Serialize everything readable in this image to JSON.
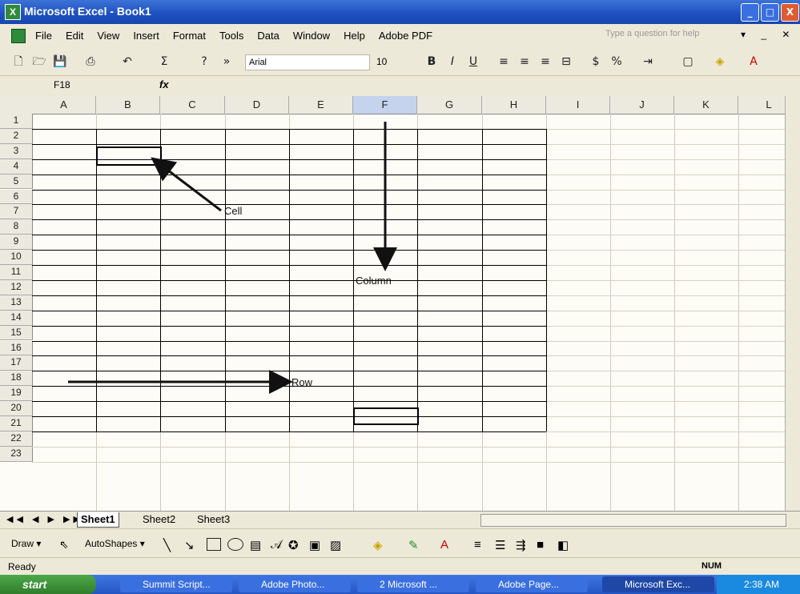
{
  "window": {
    "title": "Microsoft Excel - Book1",
    "minimize": "_",
    "maximize": "□",
    "close": "X"
  },
  "menu": {
    "items": [
      "File",
      "Edit",
      "View",
      "Insert",
      "Format",
      "Tools",
      "Data",
      "Window",
      "Help",
      "Adobe PDF"
    ],
    "help_placeholder": "Type a question for help",
    "mdi_controls": "▾ _ ✕"
  },
  "toolbar": {
    "font": "Arial",
    "font_size": "10",
    "bold": "B",
    "italic": "I",
    "underline": "U",
    "autosum": "Σ",
    "percent": "%",
    "currency": "$"
  },
  "formula_bar": {
    "name_box": "F18",
    "fx": "fx"
  },
  "grid": {
    "columns": [
      "A",
      "B",
      "C",
      "D",
      "E",
      "F",
      "G",
      "H",
      "I",
      "J",
      "K",
      "L"
    ],
    "selected_column": "F",
    "rows": [
      "1",
      "2",
      "3",
      "4",
      "5",
      "6",
      "7",
      "8",
      "9",
      "10",
      "11",
      "12",
      "13",
      "14",
      "15",
      "16",
      "17",
      "18",
      "19",
      "20",
      "21",
      "22",
      "23"
    ],
    "annotations": {
      "cell": "Cell",
      "column": "Column",
      "row": "Row"
    }
  },
  "sheets": {
    "tabs": [
      "Sheet1",
      "Sheet2",
      "Sheet3"
    ],
    "active": "Sheet1"
  },
  "drawing": {
    "draw": "Draw ▾",
    "autoshapes": "AutoShapes ▾"
  },
  "status": {
    "ready": "Ready",
    "num": "NUM"
  },
  "taskbar": {
    "start": "start",
    "tasks": [
      "Summit Script...",
      "Adobe Photo...",
      "2 Microsoft ...",
      "Adobe Page...",
      "Microsoft Exc..."
    ],
    "clock": "2:38 AM"
  }
}
